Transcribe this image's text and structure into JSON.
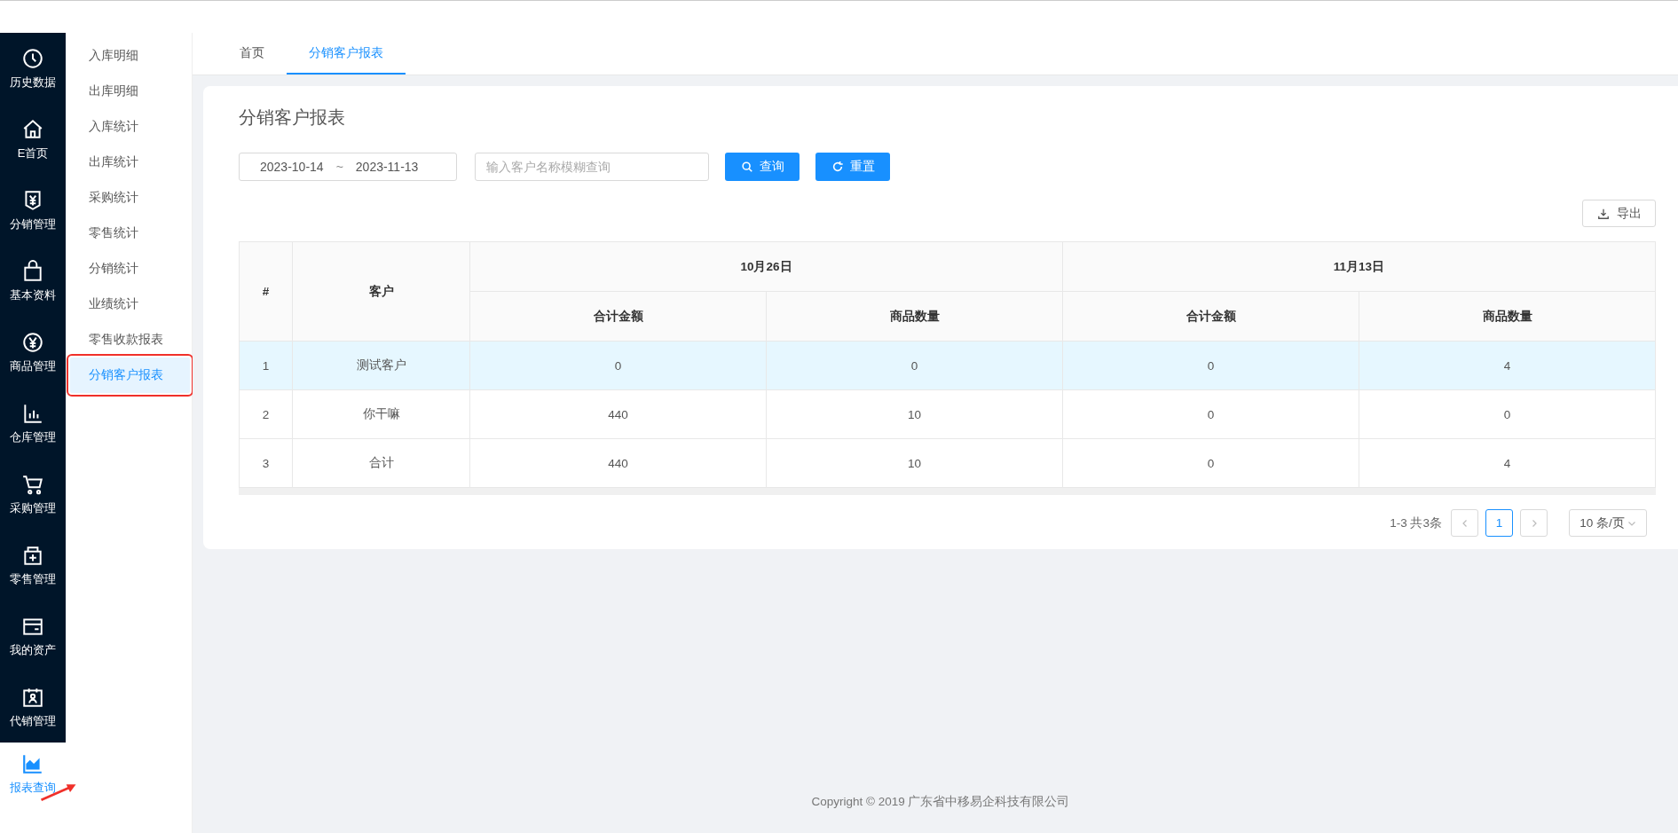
{
  "nav": [
    {
      "label": "历史数据",
      "selected": false
    },
    {
      "label": "E首页",
      "selected": false
    },
    {
      "label": "分销管理",
      "selected": false
    },
    {
      "label": "基本资料",
      "selected": false
    },
    {
      "label": "商品管理",
      "selected": false
    },
    {
      "label": "仓库管理",
      "selected": false
    },
    {
      "label": "采购管理",
      "selected": false
    },
    {
      "label": "零售管理",
      "selected": false
    },
    {
      "label": "我的资产",
      "selected": false
    },
    {
      "label": "代销管理",
      "selected": false
    },
    {
      "label": "报表查询",
      "selected": true
    }
  ],
  "submenu": [
    {
      "label": "入库明细",
      "selected": false,
      "highlighted": false
    },
    {
      "label": "出库明细",
      "selected": false,
      "highlighted": false
    },
    {
      "label": "入库统计",
      "selected": false,
      "highlighted": false
    },
    {
      "label": "出库统计",
      "selected": false,
      "highlighted": false
    },
    {
      "label": "采购统计",
      "selected": false,
      "highlighted": false
    },
    {
      "label": "零售统计",
      "selected": false,
      "highlighted": false
    },
    {
      "label": "分销统计",
      "selected": false,
      "highlighted": false
    },
    {
      "label": "业绩统计",
      "selected": false,
      "highlighted": false
    },
    {
      "label": "零售收款报表",
      "selected": false,
      "highlighted": false
    },
    {
      "label": "分销客户报表",
      "selected": true,
      "highlighted": true
    }
  ],
  "tabs": [
    {
      "label": "首页",
      "selected": false
    },
    {
      "label": "分销客户报表",
      "selected": true
    }
  ],
  "title": "分销客户报表",
  "date_range": {
    "start": "2023-10-14",
    "separator": "~",
    "end": "2023-11-13"
  },
  "search": {
    "placeholder": "输入客户名称模糊查询"
  },
  "buttons": [
    {
      "label": "查询",
      "kind": "search"
    },
    {
      "label": "重置",
      "kind": "reset"
    }
  ],
  "export_button": "导出",
  "table": {
    "index_header": "#",
    "customer_header": "客户",
    "groups": [
      {
        "label": "10月26日",
        "columns": [
          "合计金额",
          "商品数量"
        ]
      },
      {
        "label": "11月13日",
        "columns": [
          "合计金额",
          "商品数量"
        ]
      }
    ],
    "rows": [
      {
        "index": "1",
        "customer": "测试客户",
        "values": [
          "0",
          "0",
          "0",
          "4"
        ],
        "selected": true
      },
      {
        "index": "2",
        "customer": "你干嘛",
        "values": [
          "440",
          "10",
          "0",
          "0"
        ],
        "selected": false
      },
      {
        "index": "3",
        "customer": "合计",
        "values": [
          "440",
          "10",
          "0",
          "4"
        ],
        "selected": false
      }
    ]
  },
  "pagination": {
    "summary": "1-3 共3条",
    "pages": [
      {
        "label": "1",
        "selected": true
      }
    ],
    "page_size": "10 条/页"
  },
  "footer": "Copyright © 2019 广东省中移易企科技有限公司"
}
